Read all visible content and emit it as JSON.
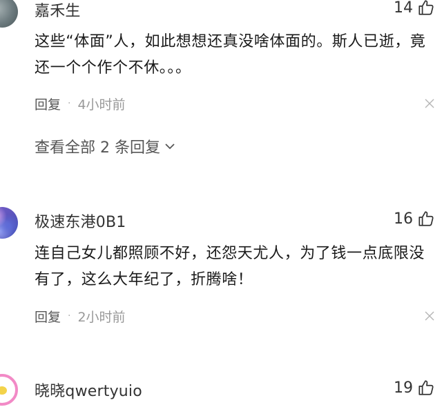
{
  "comments": [
    {
      "username": "嘉禾生",
      "likes": "14",
      "text": "这些“体面”人，如此想想还真没啥体面的。斯人已逝，竟还一个个作个不休。。。",
      "reply_label": "回复",
      "separator": "·",
      "time": "4小时前",
      "view_replies": "查看全部 2 条回复"
    },
    {
      "username": "极速东港0B1",
      "likes": "16",
      "text": "连自己女儿都照顾不好，还怨天尤人，为了钱一点底限没有了，这么大年纪了，折腾啥！",
      "reply_label": "回复",
      "separator": "·",
      "time": "2小时前"
    },
    {
      "username": "晓晓qwertyuio",
      "likes": "19"
    }
  ],
  "icons": {
    "like": "thumbs-up-icon",
    "close": "close-icon",
    "expand": "chevron-down-icon"
  },
  "colors": {
    "text_primary": "#1a1a1a",
    "text_secondary": "#555555",
    "text_muted": "#999999",
    "avatar3_ring": "#f28ac6"
  }
}
